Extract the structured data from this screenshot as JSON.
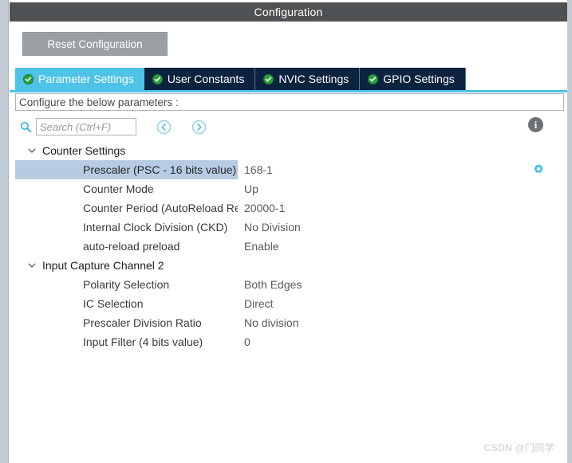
{
  "window": {
    "title": "Configuration"
  },
  "toolbar": {
    "reset_label": "Reset Configuration"
  },
  "tabs": [
    {
      "label": "Parameter Settings",
      "icon": "check-circle-icon",
      "active": true
    },
    {
      "label": "User Constants",
      "icon": "check-circle-icon",
      "active": false
    },
    {
      "label": "NVIC Settings",
      "icon": "check-circle-icon",
      "active": false
    },
    {
      "label": "GPIO Settings",
      "icon": "check-circle-icon",
      "active": false
    }
  ],
  "subheader": {
    "text": "Configure the below parameters :"
  },
  "search": {
    "placeholder": "Search (Ctrl+F)",
    "value": "",
    "icon": "search-icon",
    "prev_icon": "circle-chevron-left-icon",
    "next_icon": "circle-chevron-right-icon",
    "info_icon": "info-icon",
    "info_glyph": "i"
  },
  "tree": {
    "groups": [
      {
        "label": "Counter Settings",
        "expanded": true,
        "rows": [
          {
            "name": "Prescaler (PSC - 16 bits value)",
            "value": "168-1",
            "selected": true,
            "gear": true
          },
          {
            "name": "Counter Mode",
            "value": "Up",
            "selected": false,
            "gear": false
          },
          {
            "name": "Counter Period (AutoReload Regis...",
            "value": "20000-1",
            "selected": false,
            "gear": false
          },
          {
            "name": "Internal Clock Division (CKD)",
            "value": "No Division",
            "selected": false,
            "gear": false
          },
          {
            "name": "auto-reload preload",
            "value": "Enable",
            "selected": false,
            "gear": false
          }
        ]
      },
      {
        "label": "Input Capture Channel 2",
        "expanded": true,
        "rows": [
          {
            "name": "Polarity Selection",
            "value": "Both Edges",
            "selected": false,
            "gear": false
          },
          {
            "name": "IC Selection",
            "value": "Direct",
            "selected": false,
            "gear": false
          },
          {
            "name": "Prescaler Division Ratio",
            "value": "No division",
            "selected": false,
            "gear": false
          },
          {
            "name": "Input Filter (4 bits value)",
            "value": "0",
            "selected": false,
            "gear": false
          }
        ]
      }
    ]
  },
  "watermark": {
    "text": "CSDN @冂同学"
  },
  "colors": {
    "titlebar": "#4f5254",
    "tab_active": "#4ec3e8",
    "tab_inactive": "#0c2340",
    "row_selected": "#b7cce3",
    "check_green": "#2aa03c",
    "gear_blue": "#4ec3e8",
    "rail": "#c3ccd4"
  }
}
